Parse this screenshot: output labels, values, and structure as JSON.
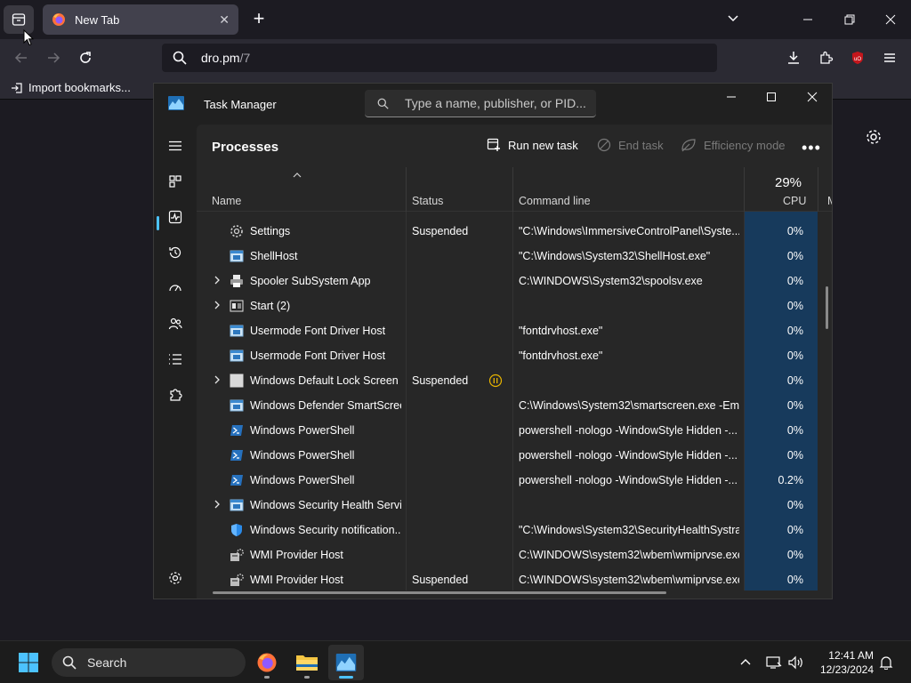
{
  "browser": {
    "tab": {
      "title": "New Tab"
    },
    "url": {
      "host": "dro.pm",
      "path": "/7"
    },
    "bookmarks": {
      "import_label": "Import bookmarks..."
    }
  },
  "task_manager": {
    "title": "Task Manager",
    "search_placeholder": "Type a name, publisher, or PID...",
    "page_title": "Processes",
    "commands": {
      "run_new_task": "Run new task",
      "end_task": "End task",
      "efficiency_mode": "Efficiency mode"
    },
    "columns": {
      "name": "Name",
      "status": "Status",
      "command_line": "Command line",
      "cpu": "CPU",
      "cpu_total": "29%",
      "next_partial": "M"
    },
    "rows": [
      {
        "name": "Settings",
        "status": "Suspended",
        "command": "\"C:\\Windows\\ImmersiveControlPanel\\Syste...",
        "cpu": "0%",
        "expandable": false,
        "paused": false,
        "icon": "gear-icon"
      },
      {
        "name": "ShellHost",
        "status": "",
        "command": "\"C:\\Windows\\System32\\ShellHost.exe\"",
        "cpu": "0%",
        "expandable": false,
        "paused": false,
        "icon": "app-window-icon"
      },
      {
        "name": "Spooler SubSystem App",
        "status": "",
        "command": "C:\\WINDOWS\\System32\\spoolsv.exe",
        "cpu": "0%",
        "expandable": true,
        "paused": false,
        "icon": "printer-icon"
      },
      {
        "name": "Start (2)",
        "status": "",
        "command": "",
        "cpu": "0%",
        "expandable": true,
        "paused": false,
        "icon": "start-app-icon"
      },
      {
        "name": "Usermode Font Driver Host",
        "status": "",
        "command": "\"fontdrvhost.exe\"",
        "cpu": "0%",
        "expandable": false,
        "paused": false,
        "icon": "app-window-icon"
      },
      {
        "name": "Usermode Font Driver Host",
        "status": "",
        "command": "\"fontdrvhost.exe\"",
        "cpu": "0%",
        "expandable": false,
        "paused": false,
        "icon": "app-window-icon"
      },
      {
        "name": "Windows Default Lock Screen ...",
        "status": "Suspended",
        "command": "",
        "cpu": "0%",
        "expandable": true,
        "paused": true,
        "icon": "blank-app-icon"
      },
      {
        "name": "Windows Defender SmartScreen",
        "status": "",
        "command": "C:\\Windows\\System32\\smartscreen.exe -Em...",
        "cpu": "0%",
        "expandable": false,
        "paused": false,
        "icon": "app-window-icon"
      },
      {
        "name": "Windows PowerShell",
        "status": "",
        "command": "powershell  -nologo -WindowStyle Hidden -...",
        "cpu": "0%",
        "expandable": false,
        "paused": false,
        "icon": "powershell-icon"
      },
      {
        "name": "Windows PowerShell",
        "status": "",
        "command": "powershell  -nologo -WindowStyle Hidden -...",
        "cpu": "0%",
        "expandable": false,
        "paused": false,
        "icon": "powershell-icon"
      },
      {
        "name": "Windows PowerShell",
        "status": "",
        "command": "powershell  -nologo -WindowStyle Hidden -...",
        "cpu": "0.2%",
        "expandable": false,
        "paused": false,
        "icon": "powershell-icon"
      },
      {
        "name": "Windows Security Health Servi...",
        "status": "",
        "command": "",
        "cpu": "0%",
        "expandable": true,
        "paused": false,
        "icon": "app-window-icon"
      },
      {
        "name": "Windows Security notification...",
        "status": "",
        "command": "\"C:\\Windows\\System32\\SecurityHealthSystra...",
        "cpu": "0%",
        "expandable": false,
        "paused": false,
        "icon": "shield-icon"
      },
      {
        "name": "WMI Provider Host",
        "status": "",
        "command": "C:\\WINDOWS\\system32\\wbem\\wmiprvse.exe",
        "cpu": "0%",
        "expandable": false,
        "paused": false,
        "icon": "wmi-icon"
      },
      {
        "name": "WMI Provider Host",
        "status": "Suspended",
        "command": "C:\\WINDOWS\\system32\\wbem\\wmiprvse.exe",
        "cpu": "0%",
        "expandable": false,
        "paused": false,
        "icon": "wmi-icon"
      }
    ]
  },
  "taskbar": {
    "search_label": "Search",
    "time": "12:41 AM",
    "date": "12/23/2024"
  },
  "colors": {
    "accent": "#4cc2ff",
    "cpu_column": "#173a5c",
    "pause": "#e8b400"
  }
}
